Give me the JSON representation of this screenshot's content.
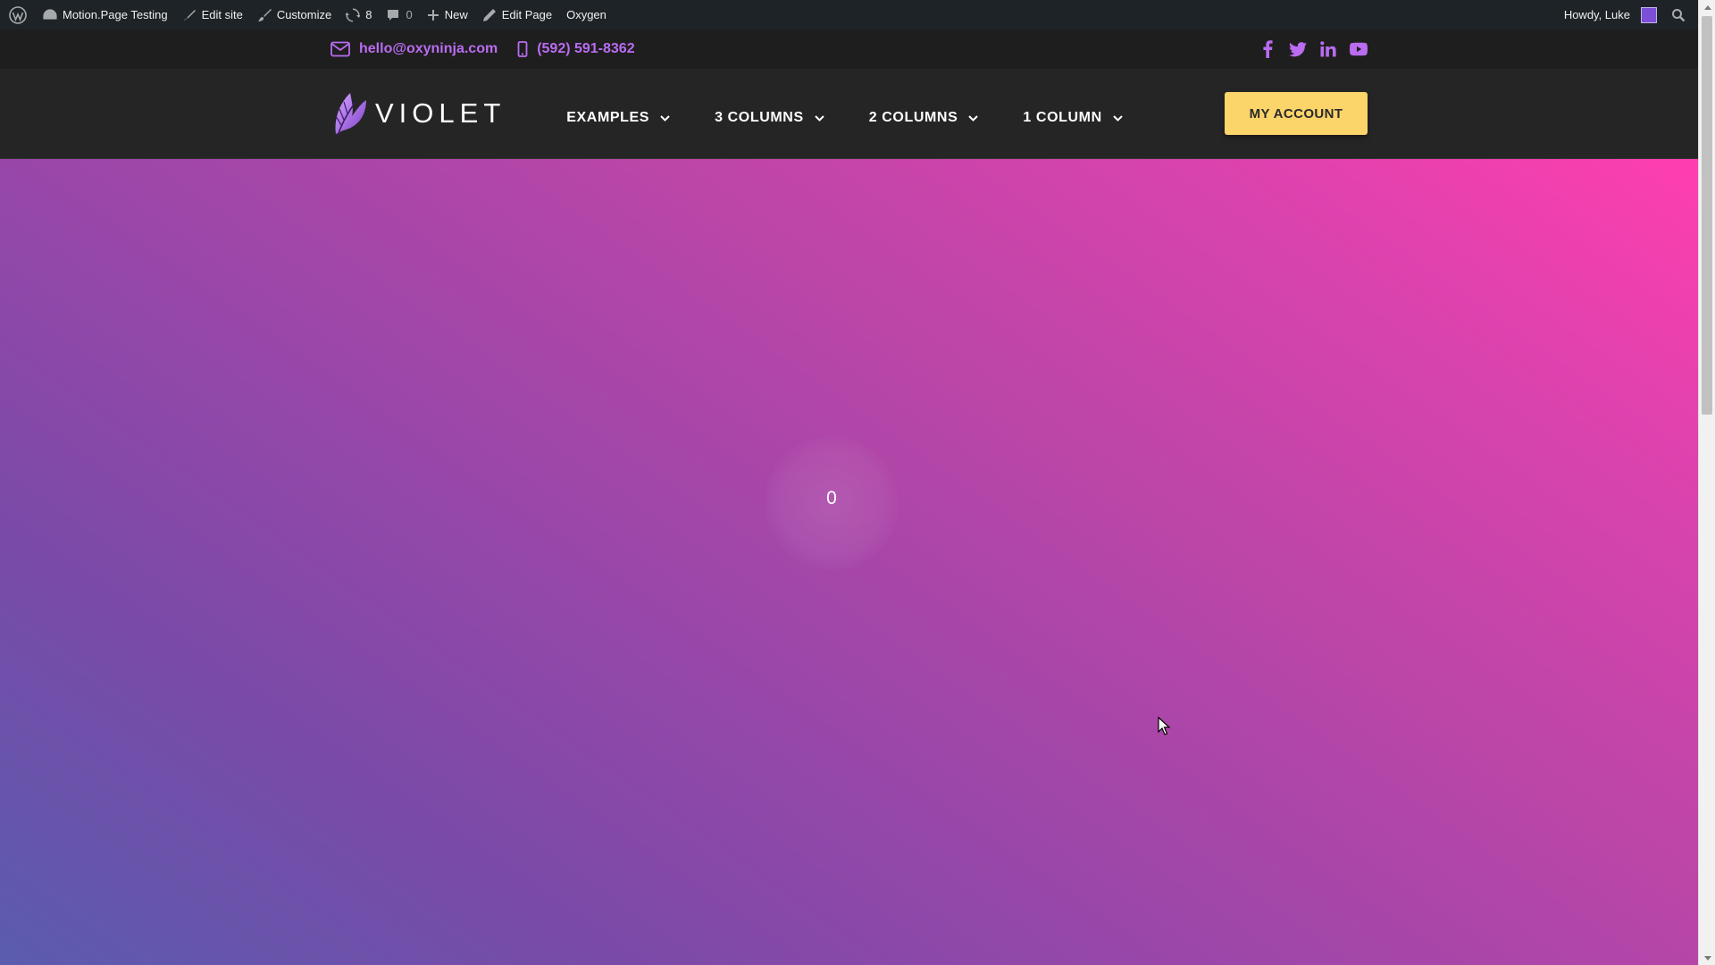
{
  "admin_bar": {
    "site_name": "Motion.Page Testing",
    "edit_site": "Edit site",
    "customize": "Customize",
    "updates_count": "8",
    "comments_count": "0",
    "new": "New",
    "edit_page": "Edit Page",
    "oxygen": "Oxygen",
    "greeting": "Howdy, Luke"
  },
  "topbar": {
    "email": "hello@oxyninja.com",
    "phone": "(592) 591-8362",
    "socials": [
      "facebook-icon",
      "twitter-icon",
      "linkedin-icon",
      "youtube-icon"
    ],
    "accent": "#b96cf0"
  },
  "header": {
    "logo_text": "VIOLET",
    "nav": [
      {
        "label": "EXAMPLES"
      },
      {
        "label": "3 COLUMNS"
      },
      {
        "label": "2 COLUMNS"
      },
      {
        "label": "1 COLUMN"
      }
    ],
    "account_button": "MY ACCOUNT",
    "button_color": "#fbd46a"
  },
  "hero": {
    "counter": "0",
    "gradient_start": "#5a5cad",
    "gradient_end": "#ff3eb0"
  }
}
